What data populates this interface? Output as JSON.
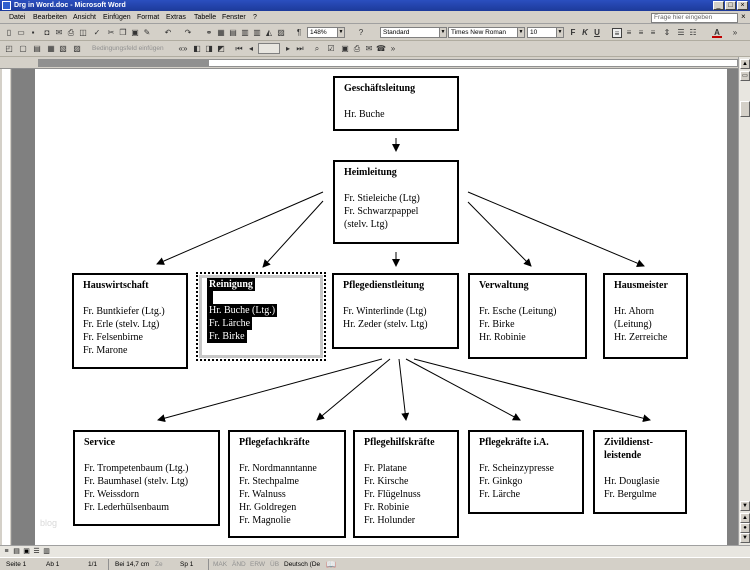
{
  "window": {
    "title": "Drg in Word.doc - Microsoft Word"
  },
  "menu": [
    "Datei",
    "Bearbeiten",
    "Ansicht",
    "Einfügen",
    "Format",
    "Extras",
    "Tabelle",
    "Fenster",
    "?"
  ],
  "help_placeholder": "Frage hier eingeben",
  "toolbar": {
    "zoom": "148%",
    "style": "Standard",
    "font": "Times New Roman",
    "font_size": "10",
    "bold": "F",
    "italic": "K",
    "underline": "U",
    "field_label": "Bedingungsfeld einfügen"
  },
  "chart": {
    "top": {
      "title": "Geschäftsleitung",
      "lines": [
        "Hr. Buche"
      ]
    },
    "second": {
      "title": "Heimleitung",
      "lines": [
        "Fr. Stieleiche (Ltg)",
        "Fr. Schwarzpappel",
        "(stelv. Ltg)"
      ]
    },
    "row2": [
      {
        "title": "Hauswirtschaft",
        "lines": [
          "Fr. Buntkiefer (Ltg.)",
          "Fr. Erle (stelv. Ltg)",
          "Fr. Felsenbirne",
          "Fr. Marone"
        ]
      },
      {
        "title": "Reinigung",
        "lines": [
          "Hr. Buche (Ltg.)",
          "Fr. Lärche",
          "Fr. Birke"
        ]
      },
      {
        "title": "Pflegedienstleitung",
        "lines": [
          "Fr. Winterlinde (Ltg)",
          "Hr. Zeder (stelv. Ltg)"
        ]
      },
      {
        "title": "Verwaltung",
        "lines": [
          "Fr. Esche (Leitung)",
          "Fr. Birke",
          "Hr. Robinie"
        ]
      },
      {
        "title": "Hausmeister",
        "lines": [
          "Hr. Ahorn",
          "(Leitung)",
          "Hr. Zerreiche"
        ]
      }
    ],
    "row3": [
      {
        "title": "Service",
        "lines": [
          "Fr. Trompetenbaum (Ltg.)",
          "Fr. Baumhasel (stelv. Ltg)",
          "Fr. Weissdorn",
          "Fr. Lederhülsenbaum"
        ]
      },
      {
        "title": "Pflegefachkräfte",
        "lines": [
          "Fr. Nordmanntanne",
          "Fr. Stechpalme",
          "Fr. Walnuss",
          "Hr. Goldregen",
          "Fr. Magnolie"
        ]
      },
      {
        "title": "Pflegehilfskräfte",
        "lines": [
          "Fr. Platane",
          "Fr. Kirsche",
          "Fr. Flügelnuss",
          "Fr. Robinie",
          "Fr. Holunder"
        ]
      },
      {
        "title": "Pflegekräfte i.A.",
        "lines": [
          "Fr. Scheinzypresse",
          "Fr. Ginkgo",
          "Fr. Lärche"
        ]
      },
      {
        "title_lines": [
          "Zivildienst-",
          "leistende"
        ],
        "lines": [
          "Hr. Douglasie",
          "Fr. Bergulme"
        ]
      }
    ]
  },
  "watermark": "blog",
  "status": {
    "page": "Seite 1",
    "section": "Ab 1",
    "pages": "1/1",
    "position": "Bei 14,7 cm",
    "line": "Ze",
    "column": "Sp 1",
    "mak": "MAK",
    "and": "ÄND",
    "erw": "ERW",
    "ub": "ÜB",
    "language": "Deutsch (De"
  }
}
